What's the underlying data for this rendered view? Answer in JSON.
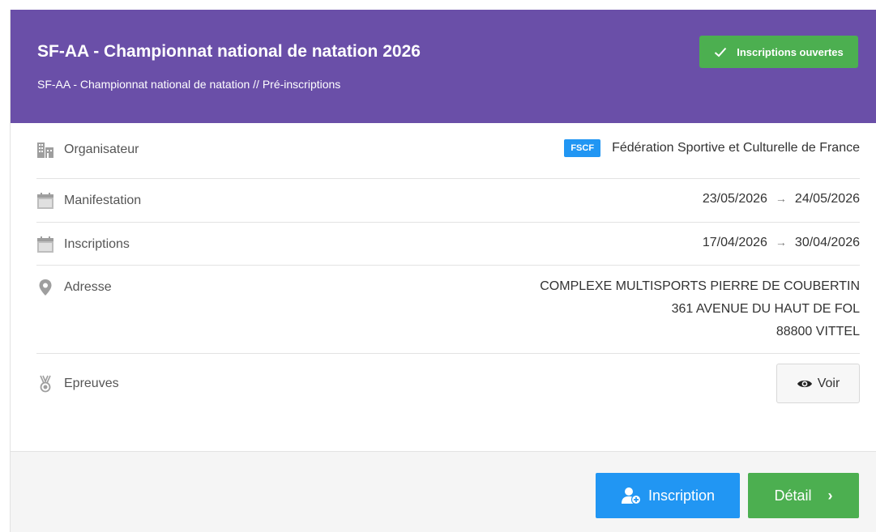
{
  "header": {
    "title": "SF-AA - Championnat national de natation 2026",
    "subtitle": "SF-AA - Championnat national de natation // Pré-inscriptions",
    "status_badge": "Inscriptions ouvertes",
    "status_icon": "check-icon",
    "bg_color": "#6a4fa8"
  },
  "rows": {
    "organisateur": {
      "label": "Organisateur",
      "icon": "building-icon",
      "badge": "FSCF",
      "value": "Fédération Sportive et Culturelle de France"
    },
    "manifestation": {
      "label": "Manifestation",
      "icon": "calendar-icon",
      "start": "23/05/2026",
      "end": "24/05/2026"
    },
    "inscriptions": {
      "label": "Inscriptions",
      "icon": "calendar-icon",
      "start": "17/04/2026",
      "end": "30/04/2026"
    },
    "adresse": {
      "label": "Adresse",
      "icon": "map-marker-icon",
      "lines": [
        "COMPLEXE MULTISPORTS PIERRE DE COUBERTIN",
        "361 AVENUE DU HAUT DE FOL",
        "88800 VITTEL"
      ]
    },
    "epreuves": {
      "label": "Epreuves",
      "icon": "medal-icon",
      "button_label": "Voir",
      "button_icon": "eye-icon"
    }
  },
  "footer": {
    "inscription_label": "Inscription",
    "inscription_icon": "user-plus-icon",
    "detail_label": "Détail",
    "detail_icon": "chevron-right-icon",
    "primary_color": "#2196f3",
    "success_color": "#4caf50"
  }
}
